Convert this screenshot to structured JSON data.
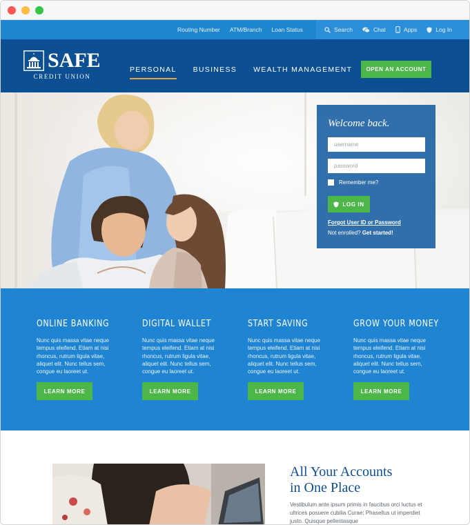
{
  "utility_bar": {
    "links": [
      "Routing Number",
      "ATM/Branch",
      "Loan Status"
    ],
    "tools": [
      {
        "label": "Search",
        "icon": "search-icon"
      },
      {
        "label": "Chat",
        "icon": "chat-icon"
      },
      {
        "label": "Apps",
        "icon": "phone-icon"
      },
      {
        "label": "Log In",
        "icon": "shield-icon"
      }
    ]
  },
  "header": {
    "logo_name": "SAFE",
    "logo_sub": "CREDIT UNION",
    "nav": [
      {
        "label": "PERSONAL",
        "active": true
      },
      {
        "label": "BUSINESS",
        "active": false
      },
      {
        "label": "WEALTH MANAGEMENT",
        "active": false
      }
    ],
    "cta_label": "OPEN AN ACCOUNT"
  },
  "login": {
    "title": "Welcome back.",
    "username_placeholder": "username",
    "password_placeholder": "password",
    "remember_label": "Remember me?",
    "button_label": "LOG IN",
    "forgot_label": "Forgot User ID or Password",
    "enroll_text": "Not enrolled?",
    "enroll_link": "Get started!"
  },
  "features": [
    {
      "title": "ONLINE BANKING",
      "body": "Nunc quis massa vitae neque tempus eleifend. Etiam at nisi rhoncus, rutrum ligula vitae, aliquet elit. Nunc tellus sem, congue eu laoreet ut.",
      "button": "LEARN MORE"
    },
    {
      "title": "DIGITAL WALLET",
      "body": "Nunc quis massa vitae neque tempus eleifend. Etiam at nisi rhoncus, rutrum ligula vitae, aliquet elit. Nunc tellus sem, congue eu laoreet ut.",
      "button": "LEARN MORE"
    },
    {
      "title": "START SAVING",
      "body": "Nunc quis massa vitae neque tempus eleifend. Etiam at nisi rhoncus, rutrum ligula vitae, aliquet elit. Nunc tellus sem, congue eu laoreet ut.",
      "button": "LEARN MORE"
    },
    {
      "title": "GROW YOUR MONEY",
      "body": "Nunc quis massa vitae neque tempus eleifend. Etiam at nisi rhoncus, rutrum ligula vitae, aliquet elit. Nunc tellus sem, congue eu laoreet ut.",
      "button": "LEARN MORE"
    }
  ],
  "accounts": {
    "title_line1": "All Your Accounts",
    "title_line2": "in One Place",
    "body": "Vestibulum ante ipsum primis in faucibus orci luctus et ultrices posuere cubilia Curae; Phasellus ut imperdiet justo. Quisque pellentesque"
  },
  "colors": {
    "utility_blue": "#1e85d1",
    "nav_navy": "#0d4f93",
    "accent_green": "#4cb748",
    "feature_blue": "#1f84d2",
    "active_underline": "#e5a33a"
  }
}
